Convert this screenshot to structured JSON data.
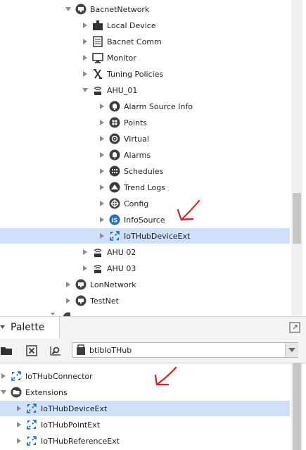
{
  "tree": {
    "items": [
      {
        "label": "BacnetNetwork",
        "icon": "network-icon"
      },
      {
        "label": "Local Device",
        "icon": "local-device-icon"
      },
      {
        "label": "Bacnet Comm",
        "icon": "comm-icon"
      },
      {
        "label": "Monitor",
        "icon": "monitor-icon"
      },
      {
        "label": "Tuning Policies",
        "icon": "tuning-icon"
      },
      {
        "label": "AHU_01",
        "icon": "device-icon"
      },
      {
        "label": "Alarm Source Info",
        "icon": "alarm-icon"
      },
      {
        "label": "Points",
        "icon": "points-icon"
      },
      {
        "label": "Virtual",
        "icon": "virtual-icon"
      },
      {
        "label": "Alarms",
        "icon": "alarm-icon"
      },
      {
        "label": "Schedules",
        "icon": "schedules-icon"
      },
      {
        "label": "Trend Logs",
        "icon": "trend-logs-icon"
      },
      {
        "label": "Config",
        "icon": "config-icon"
      },
      {
        "label": "InfoSource",
        "icon": "info-source-icon"
      },
      {
        "label": "IoTHubDeviceExt",
        "icon": "iot-hub-icon"
      },
      {
        "label": "AHU 02",
        "icon": "device-icon"
      },
      {
        "label": "AHU 03",
        "icon": "device-icon"
      },
      {
        "label": "LonNetwork",
        "icon": "network-icon"
      },
      {
        "label": "TestNet",
        "icon": "network-icon"
      }
    ]
  },
  "palette": {
    "tab_title": "Palette",
    "module_name": "btibIoTHub",
    "items": [
      {
        "label": "IoTHubConnector",
        "icon": "iot-hub-icon"
      },
      {
        "label": "Extensions",
        "icon": "folder-icon"
      },
      {
        "label": "IoTHubDeviceExt",
        "icon": "iot-hub-icon"
      },
      {
        "label": "IoTHubPointExt",
        "icon": "iot-hub-icon"
      },
      {
        "label": "IoTHubReferenceExt",
        "icon": "iot-hub-icon"
      }
    ]
  },
  "colors": {
    "selection": "#cfe0fb",
    "annotation_red": "#e02020",
    "iot_blue": "#1565c0"
  }
}
